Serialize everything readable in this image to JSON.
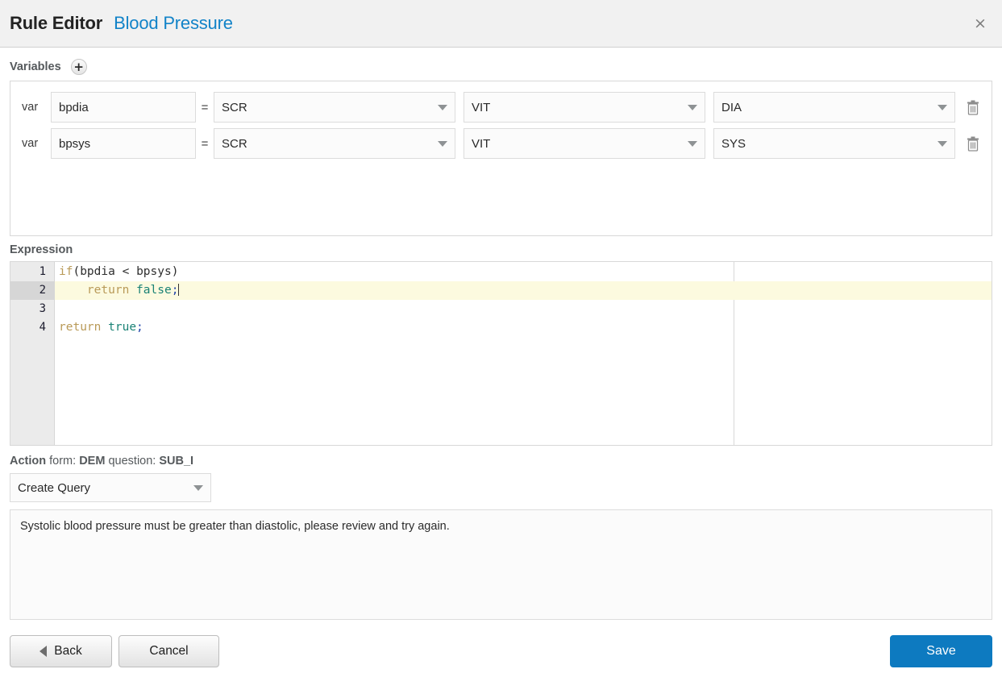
{
  "header": {
    "title": "Rule Editor",
    "subtitle": "Blood Pressure",
    "close_label": "×"
  },
  "variables": {
    "section_label": "Variables",
    "add_label": "+",
    "rows": [
      {
        "keyword": "var",
        "name": "bpdia",
        "equals": "=",
        "source": "SCR",
        "form": "VIT",
        "item": "DIA"
      },
      {
        "keyword": "var",
        "name": "bpsys",
        "equals": "=",
        "source": "SCR",
        "form": "VIT",
        "item": "SYS"
      }
    ]
  },
  "expression": {
    "section_label": "Expression",
    "lines": [
      {
        "number": "1",
        "active": false,
        "text": "if(bpdia < bpsys)"
      },
      {
        "number": "2",
        "active": true,
        "text": "    return false;"
      },
      {
        "number": "3",
        "active": false,
        "text": ""
      },
      {
        "number": "4",
        "active": false,
        "text": "return true;"
      }
    ]
  },
  "action": {
    "label_action": "Action",
    "label_form": "form:",
    "form_value": "DEM",
    "label_question": "question:",
    "question_value": "SUB_I",
    "type": "Create Query",
    "message": "Systolic blood pressure must be greater than diastolic, please review and try again."
  },
  "footer": {
    "back_label": "Back",
    "cancel_label": "Cancel",
    "save_label": "Save"
  },
  "colors": {
    "accent_blue": "#1283c8",
    "save_blue": "#0d7ac0",
    "active_line": "#fcfadf",
    "keyword": "#b99a58",
    "boolean": "#1a8275"
  }
}
